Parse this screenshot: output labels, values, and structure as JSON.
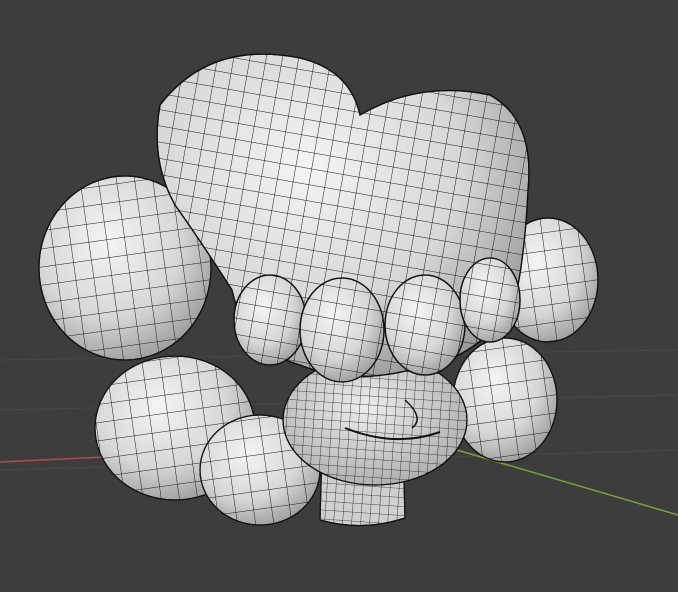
{
  "viewport": {
    "background": "#3d3d3d",
    "grid_color": "#4a4a4a",
    "x_axis_color": "#b24a55",
    "y_axis_color": "#7aa23a",
    "mesh_fill": "#d9d9d9",
    "mesh_wire": "#1a1a1a",
    "shading": "smooth",
    "display": "wireframe-overlay"
  },
  "model": {
    "parts": [
      "fist",
      "cloud-puffs",
      "head",
      "neck"
    ]
  }
}
